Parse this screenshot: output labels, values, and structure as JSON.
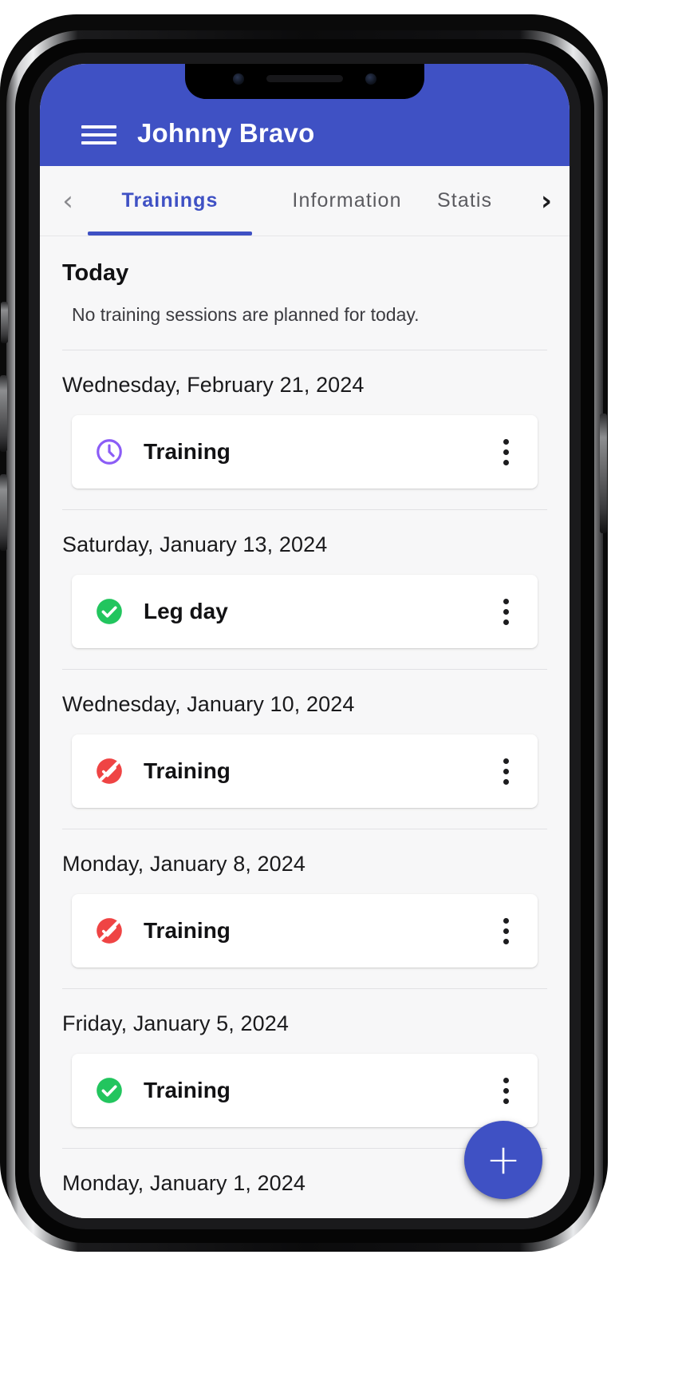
{
  "app": {
    "bar": {
      "menu_icon": "hamburger-menu-icon",
      "title": "Johnny Bravo",
      "background_color": "#3f51c4"
    },
    "tabs": {
      "prev_icon": "chevron-left-icon",
      "next_icon": "chevron-right-icon",
      "active_index": 0,
      "items": [
        {
          "label": "Trainings"
        },
        {
          "label": "Information"
        },
        {
          "label": "Statis"
        }
      ]
    },
    "today": {
      "heading": "Today",
      "empty_message": "No training sessions are planned for today."
    },
    "sessions": [
      {
        "date": "Wednesday, February 21, 2024",
        "title": "Training",
        "status": "planned",
        "status_icon": "clock-icon",
        "status_color": "#8b5cf6",
        "menu_icon": "more-vertical-icon"
      },
      {
        "date": "Saturday, January 13, 2024",
        "title": "Leg day",
        "status": "completed",
        "status_icon": "check-circle-icon",
        "status_color": "#22c55e",
        "menu_icon": "more-vertical-icon"
      },
      {
        "date": "Wednesday, January 10, 2024",
        "title": "Training",
        "status": "cancelled",
        "status_icon": "check-circle-off-icon",
        "status_color": "#ef4444",
        "menu_icon": "more-vertical-icon"
      },
      {
        "date": "Monday, January 8, 2024",
        "title": "Training",
        "status": "cancelled",
        "status_icon": "check-circle-off-icon",
        "status_color": "#ef4444",
        "menu_icon": "more-vertical-icon"
      },
      {
        "date": "Friday, January 5, 2024",
        "title": "Training",
        "status": "completed",
        "status_icon": "check-circle-icon",
        "status_color": "#22c55e",
        "menu_icon": "more-vertical-icon"
      },
      {
        "date": "Monday, January 1, 2024",
        "title": "",
        "status": "",
        "status_icon": "",
        "status_color": "",
        "menu_icon": ""
      }
    ],
    "fab": {
      "label": "+",
      "icon": "plus-icon",
      "color": "#3f51c4"
    }
  }
}
